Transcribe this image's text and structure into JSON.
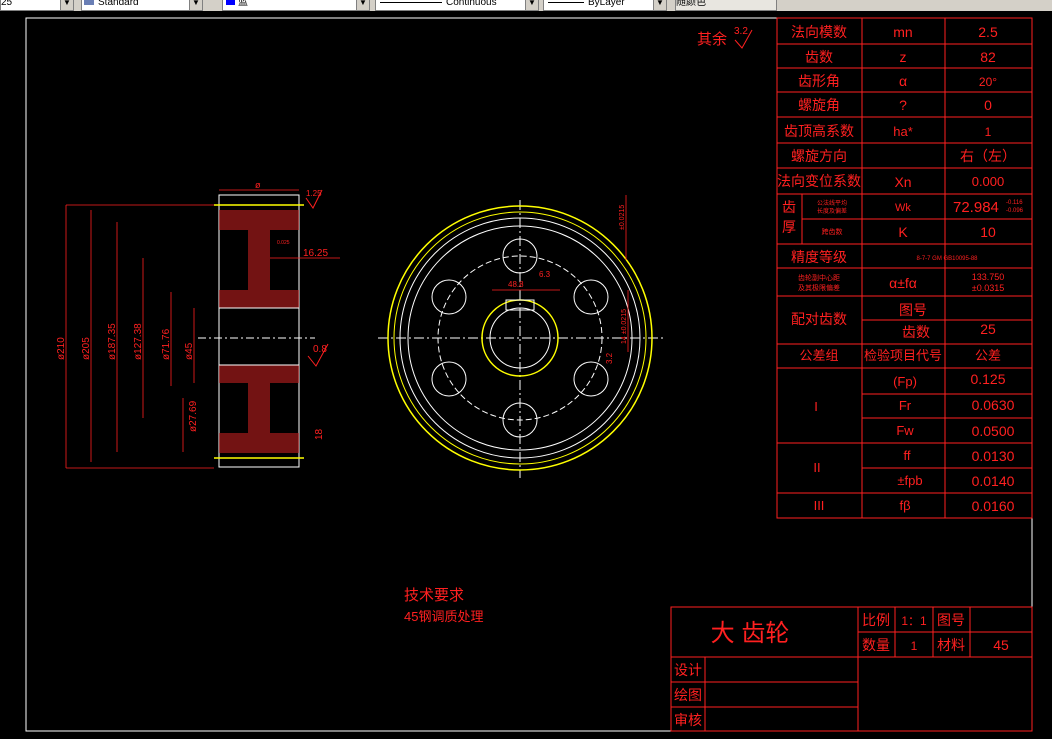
{
  "toolbar": {
    "scale_field": "25",
    "text_style": "Standard",
    "color": "蓝",
    "color_hex": "#0000ff",
    "linetype": "Continuous",
    "lineweight": "ByLayer",
    "plot_style": "随颜色"
  },
  "drawing": {
    "roughness_note": "其余",
    "roughness_value": "3.2",
    "side_view_dims": {
      "d210": "ø210",
      "d205": "ø205",
      "d187": "ø187.35",
      "d127": "ø127.38",
      "d71": "ø71.76",
      "d45": "ø45",
      "d27": "ø27.69",
      "width_top": "ø",
      "rough_top": "1.25",
      "dim_1625": "16.25",
      "rough_08": "0.8",
      "rough_18": "18",
      "small_label": "0.025"
    },
    "front_view_dims": {
      "keyway_depth": "48.8",
      "keyway_width": "6.3",
      "tol_vertical": "±0.0215",
      "tol_right": "14 ±0.0215",
      "rough_32": "3.2"
    },
    "tech_req_title": "技术要求",
    "tech_req_text": "45钢调质处理"
  },
  "params_table": {
    "rows": [
      {
        "name": "法向模数",
        "symbol": "mn",
        "value": "2.5"
      },
      {
        "name": "齿数",
        "symbol": "z",
        "value": "82"
      },
      {
        "name": "齿形角",
        "symbol": "α",
        "value": "20°"
      },
      {
        "name": "螺旋角",
        "symbol": "?",
        "value": "0"
      },
      {
        "name": "齿顶高系数",
        "symbol": "ha*",
        "value": "1"
      },
      {
        "name": "螺旋方向",
        "symbol": "",
        "value": "右（左）"
      },
      {
        "name": "法向变位系数",
        "symbol": "Xn",
        "value": "0.000"
      }
    ],
    "thickness_label_1": "齿",
    "thickness_label_2": "厚",
    "wk_label_1": "公法线平均",
    "wk_label_2": "长度及偏差",
    "wk_symbol": "Wk",
    "wk_value": "72.984",
    "wk_tol_upper": "-0.116",
    "wk_tol_lower": "-0.096",
    "k_label": "跨齿数",
    "k_symbol": "K",
    "k_value": "10",
    "precision_label": "精度等级",
    "precision_value": "8-7-7 GM GB10095-88",
    "center_label_1": "齿轮副中心距",
    "center_label_2": "及其极限偏差",
    "center_symbol": "α±fα",
    "center_value_1": "133.750",
    "center_value_2": "±0.0315",
    "mate_label": "配对齿数",
    "mate_drawing_no": "图号",
    "mate_teeth": "齿数",
    "mate_teeth_value": "25",
    "tol_header_group": "公差组",
    "tol_header_item": "检验项目代号",
    "tol_header_tol": "公差",
    "groups": [
      {
        "group": "I",
        "items": [
          {
            "code": "(Fp)",
            "value": "0.125"
          },
          {
            "code": "Fr",
            "value": "0.0630"
          },
          {
            "code": "Fw",
            "value": "0.0500"
          }
        ]
      },
      {
        "group": "II",
        "items": [
          {
            "code": "ff",
            "value": "0.0130"
          },
          {
            "code": "±fpb",
            "value": "0.0140"
          }
        ]
      },
      {
        "group": "III",
        "items": [
          {
            "code": "fβ",
            "value": "0.0160"
          }
        ]
      }
    ]
  },
  "title_block": {
    "part_name": "大 齿轮",
    "scale_label": "比例",
    "scale_value": "1：1",
    "drawing_no_label": "图号",
    "qty_label": "数量",
    "qty_value": "1",
    "material_label": "材料",
    "material_value": "45",
    "design_label": "设计",
    "draw_label": "绘图",
    "review_label": "审核"
  }
}
